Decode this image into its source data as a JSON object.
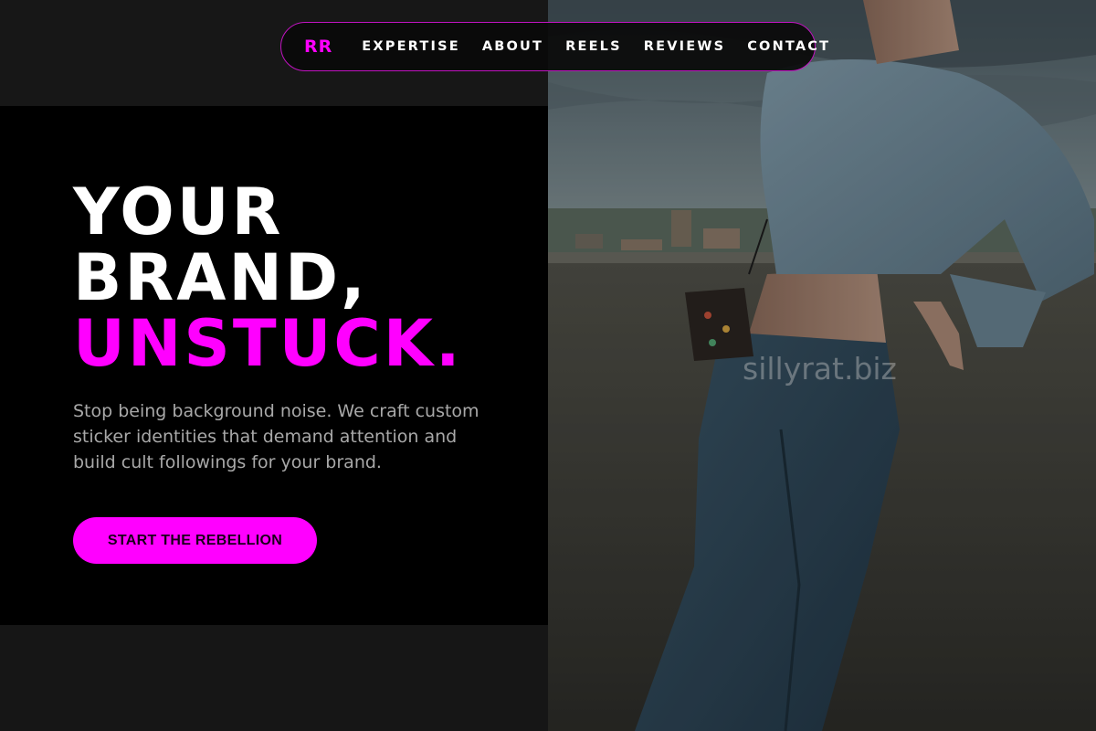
{
  "nav": {
    "logo": "RR",
    "links": [
      "EXPERTISE",
      "ABOUT",
      "REELS",
      "REVIEWS",
      "CONTACT"
    ]
  },
  "hero": {
    "heading_line1": "YOUR",
    "heading_line2": "BRAND,",
    "heading_accent": "UNSTUCK.",
    "description": "Stop being background noise. We craft custom sticker identities that demand attention and build cult followings for your brand.",
    "cta_label": "START THE REBELLION"
  },
  "photo": {
    "watermark": "sillyrat.biz",
    "alt": "Woman in cropped denim jacket and jeans leaning against a concrete wall"
  },
  "colors": {
    "accent": "#ff00ff",
    "panel_black": "#000000",
    "panel_dark": "#171717",
    "body_text": "#a8a8a8",
    "heading": "#ffffff"
  }
}
